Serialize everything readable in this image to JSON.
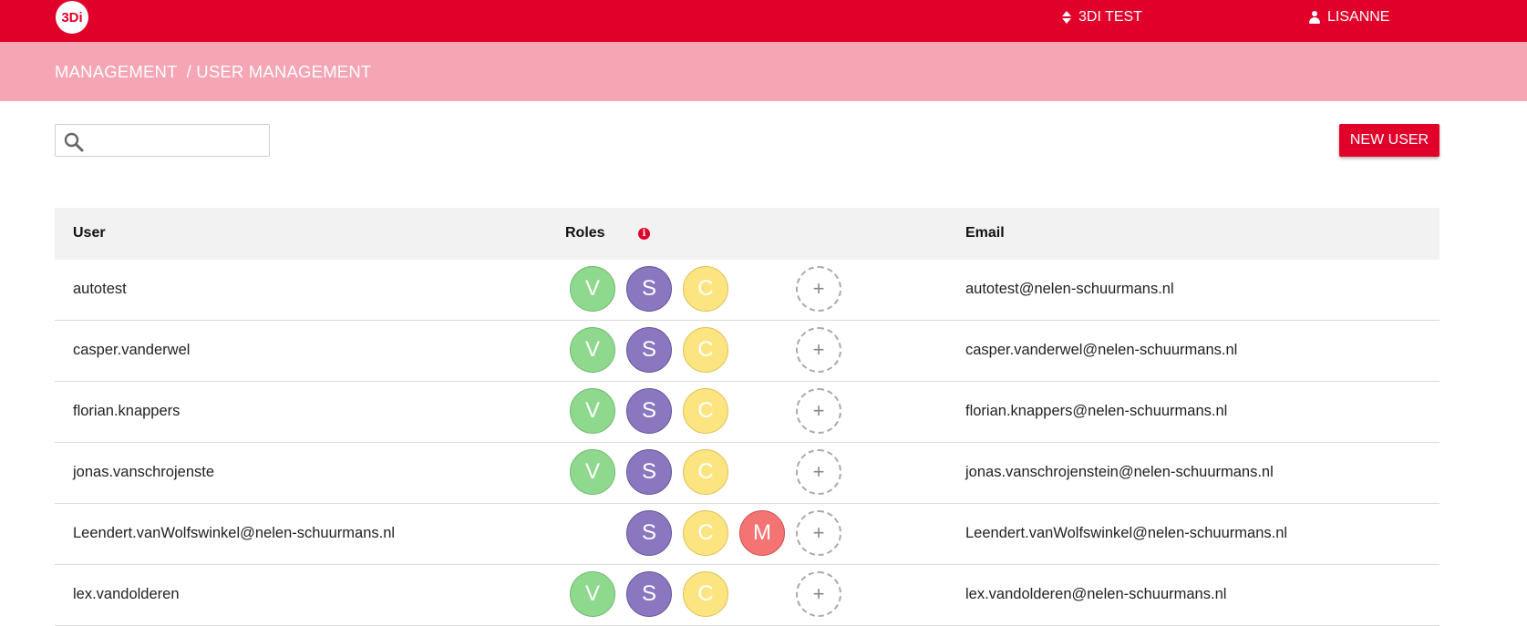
{
  "header": {
    "logo_text": "3Di",
    "organisation": "3DI TEST",
    "user": "LISANNE",
    "brand_color": "#e0002a"
  },
  "breadcrumb": {
    "items": [
      "MANAGEMENT",
      "/ USER MANAGEMENT"
    ]
  },
  "search": {
    "placeholder": "",
    "value": ""
  },
  "toolbar": {
    "new_user_label": "NEW USER"
  },
  "table": {
    "columns": {
      "user": "User",
      "roles": "Roles",
      "email": "Email"
    },
    "info_icon_text": "i",
    "add_role_symbol": "+",
    "rows": [
      {
        "user": "autotest",
        "roles": [
          "V",
          "S",
          "C"
        ],
        "email": "autotest@nelen-schuurmans.nl"
      },
      {
        "user": "casper.vanderwel",
        "roles": [
          "V",
          "S",
          "C"
        ],
        "email": "casper.vanderwel@nelen-schuurmans.nl"
      },
      {
        "user": "florian.knappers",
        "roles": [
          "V",
          "S",
          "C"
        ],
        "email": "florian.knappers@nelen-schuurmans.nl"
      },
      {
        "user": "jonas.vanschrojenste",
        "roles": [
          "V",
          "S",
          "C"
        ],
        "email": "jonas.vanschrojenstein@nelen-schuurmans.nl"
      },
      {
        "user": "Leendert.vanWolfswinkel@nelen-schuurmans.nl",
        "roles": [
          "S",
          "C",
          "M"
        ],
        "email": "Leendert.vanWolfswinkel@nelen-schuurmans.nl"
      },
      {
        "user": "lex.vandolderen",
        "roles": [
          "V",
          "S",
          "C"
        ],
        "email": "lex.vandolderen@nelen-schuurmans.nl"
      }
    ]
  },
  "role_colors": {
    "V": "#8fd98f",
    "S": "#8a77bf",
    "C": "#fce480",
    "M": "#f47474"
  }
}
